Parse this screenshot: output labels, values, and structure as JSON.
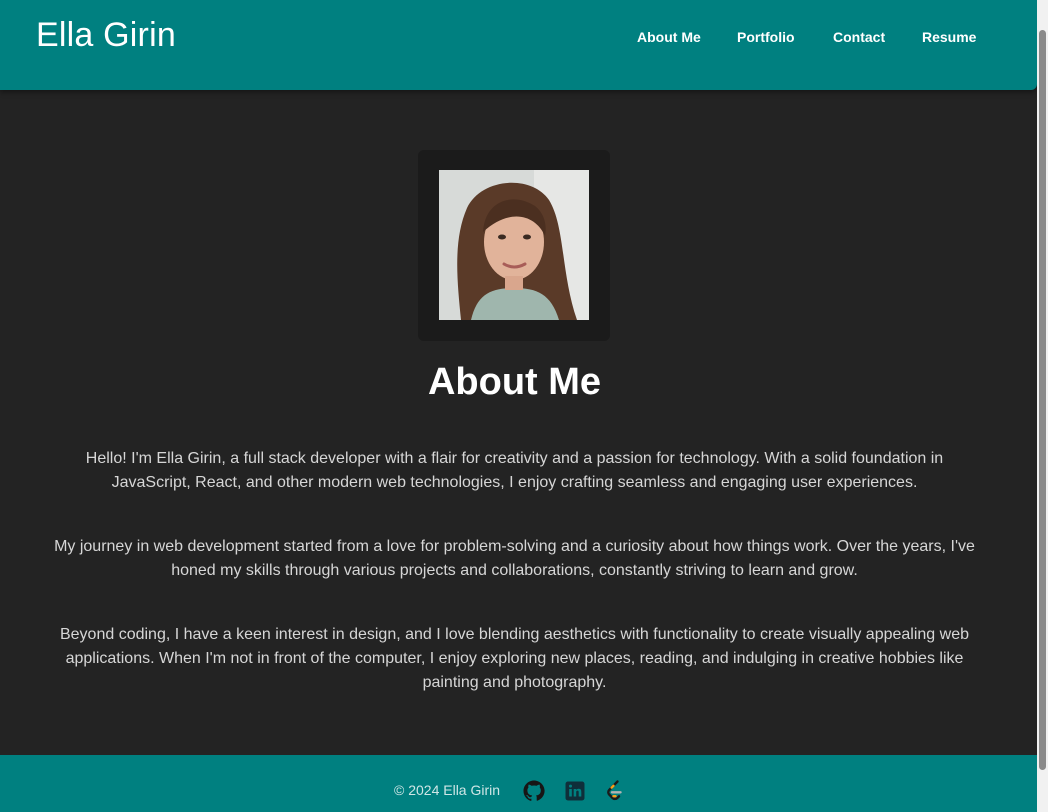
{
  "header": {
    "brand": "Ella Girin",
    "nav": [
      "About Me",
      "Portfolio",
      "Contact",
      "Resume"
    ]
  },
  "about": {
    "photo_alt": "Ella Girin",
    "title": "About Me",
    "paragraphs": [
      "Hello! I'm Ella Girin, a full stack developer with a flair for creativity and a passion for technology. With a solid foundation in JavaScript, React, and other modern web technologies, I enjoy crafting seamless and engaging user experiences.",
      "My journey in web development started from a love for problem-solving and a curiosity about how things work. Over the years, I've honed my skills through various projects and collaborations, constantly striving to learn and grow.",
      "Beyond coding, I have a keen interest in design, and I love blending aesthetics with functionality to create visually appealing web applications. When I'm not in front of the computer, I enjoy exploring new places, reading, and indulging in creative hobbies like painting and photography."
    ]
  },
  "footer": {
    "copyright": "© 2024 Ella Girin",
    "icons": [
      "github-icon",
      "linkedin-icon",
      "leetcode-icon"
    ]
  },
  "colors": {
    "header": "#008080",
    "background": "#232323",
    "text": "#d6d6d6"
  }
}
